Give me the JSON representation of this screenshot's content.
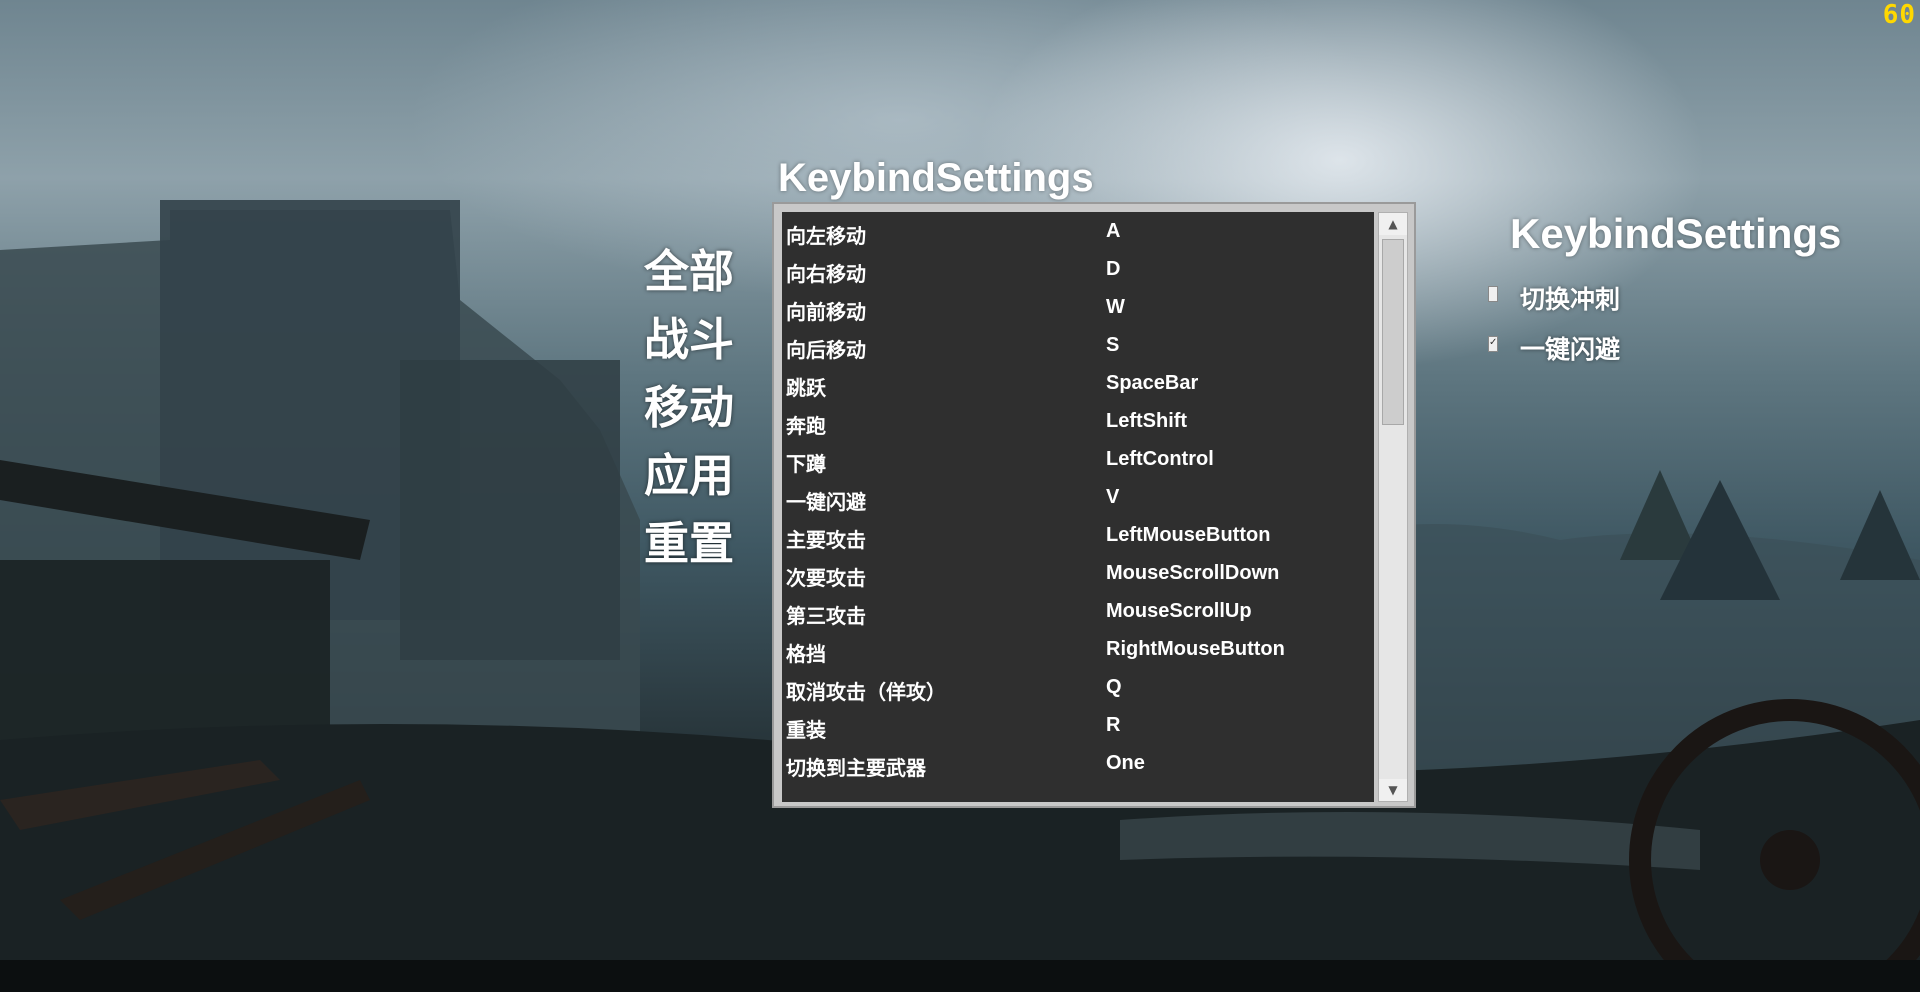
{
  "fps": "60",
  "categories": [
    "全部",
    "战斗",
    "移动",
    "应用",
    "重置"
  ],
  "panel_title": "KeybindSettings",
  "bindings": [
    {
      "action": "向左移动",
      "key": "A"
    },
    {
      "action": "向右移动",
      "key": "D"
    },
    {
      "action": "向前移动",
      "key": "W"
    },
    {
      "action": "向后移动",
      "key": "S"
    },
    {
      "action": "跳跃",
      "key": "SpaceBar"
    },
    {
      "action": "奔跑",
      "key": "LeftShift"
    },
    {
      "action": "下蹲",
      "key": "LeftControl"
    },
    {
      "action": "一键闪避",
      "key": "V"
    },
    {
      "action": "主要攻击",
      "key": "LeftMouseButton"
    },
    {
      "action": "次要攻击",
      "key": "MouseScrollDown"
    },
    {
      "action": "第三攻击",
      "key": "MouseScrollUp"
    },
    {
      "action": "格挡",
      "key": "RightMouseButton"
    },
    {
      "action": "取消攻击（佯攻）",
      "key": "Q"
    },
    {
      "action": "重装",
      "key": "R"
    },
    {
      "action": "切换到主要武器",
      "key": "One"
    }
  ],
  "right_panel": {
    "title": "KeybindSettings",
    "toggles": [
      {
        "label": "切换冲刺",
        "checked": false
      },
      {
        "label": "一键闪避",
        "checked": true
      }
    ]
  }
}
